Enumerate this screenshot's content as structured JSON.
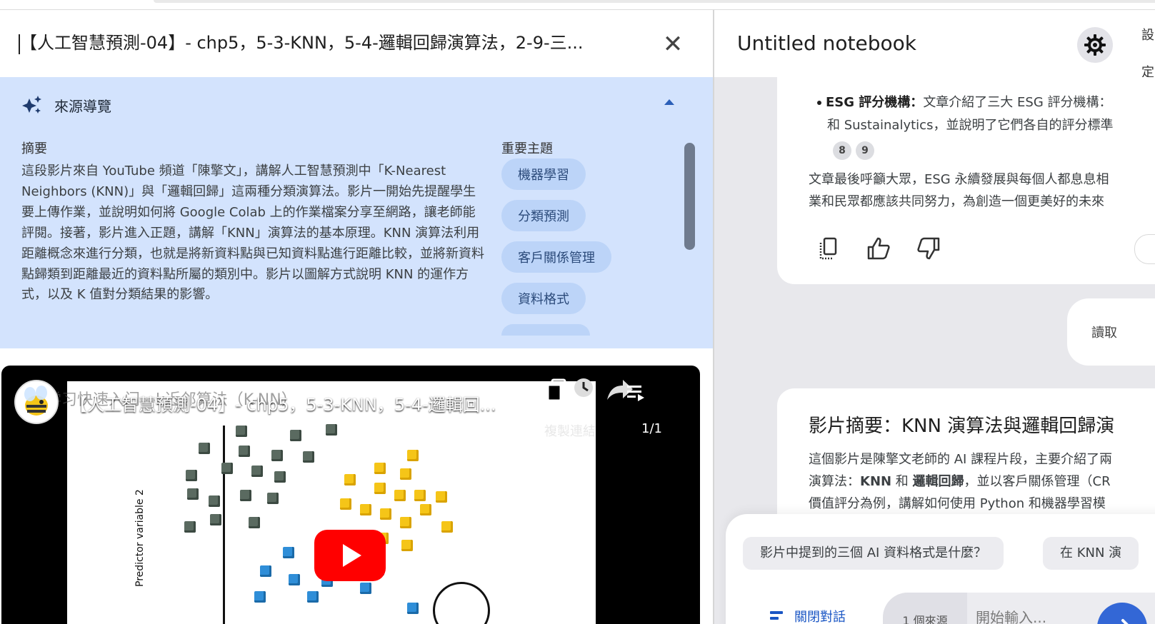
{
  "source_panel": {
    "title": "【人工智慧預測-04】- chp5，5-3-KNN，5-4-邏輯回歸演算法，2-9-三...",
    "close_glyph": "✕"
  },
  "guide": {
    "title": "來源導覽",
    "summary_label": "摘要",
    "summary_text": "這段影片來自 YouTube 頻道「陳擎文」，講解人工智慧預測中「K-Nearest Neighbors (KNN)」與「邏輯回歸」這兩種分類演算法。影片一開始先提醒學生要上傳作業，並說明如何將 Google Colab 上的作業檔案分享至網路，讓老師能評閱。接著，影片進入正題，講解「KNN」演算法的基本原理。KNN 演算法利用距離概念來進行分類，也就是將新資料點與已知資料點進行距離比較，並將新資料點歸類到距離最近的資料點所屬的類別中。影片以圖解方式說明 KNN 的運作方式，以及 K 值對分類結果的影響。",
    "topics_label": "重要主題",
    "topics": [
      "機器學習",
      "分類預測",
      "客戶關係管理",
      "資料格式"
    ]
  },
  "video": {
    "title": "【人工智慧預測-04】- chp5，5-3-KNN，5-4-邏輯回...",
    "slide_title": "机器学习快速入门—k近邻算法（K-NN）",
    "y_axis_label": "Predictor variable 2",
    "copy_link_label": "複製連結",
    "page_count": "1/1"
  },
  "notebook": {
    "title": "Untitled notebook",
    "settings_label": "設定",
    "bullet_label": "ESG 評分機構：",
    "bullet_text": "文章介紹了三大 ESG 評分機構：",
    "bullet_line2": "和 Sustainalytics，並說明了它們各自的評分標準",
    "citations": [
      "8",
      "9"
    ],
    "paragraph_line1": "文章最後呼籲大眾，ESG 永續發展與每個人都息息相",
    "paragraph_line2": "業和民眾都應該共同努力，為創造一個更美好的未來",
    "read_label": "讀取",
    "card2_title": "影片摘要：KNN 演算法與邏輯回歸演",
    "card2_line1": "這個影片是陳擎文老師的 AI 課程片段，主要介紹了兩",
    "card2_line2_plain1": "演算法：",
    "card2_line2_bold1": "KNN",
    "card2_line2_plain2": " 和 ",
    "card2_line2_bold2": "邏輯回歸",
    "card2_line2_plain3": "，並以客戶關係管理（CR",
    "card2_line3": "價值評分為例，講解如何使用 Python 和機器學習模"
  },
  "composer": {
    "suggestion_1": "影片中提到的三個 AI 資料格式是什麼？",
    "suggestion_2": "在 KNN 演",
    "close_chat_label": "關閉對話",
    "source_count": "1 個來源",
    "input_placeholder": "開始輸入..."
  },
  "colors": {
    "guide_bg": "#d3e3fd",
    "chip_bg": "#bcd4f8",
    "accent_blue": "#3367d6",
    "youtube_red": "#ff0000"
  }
}
